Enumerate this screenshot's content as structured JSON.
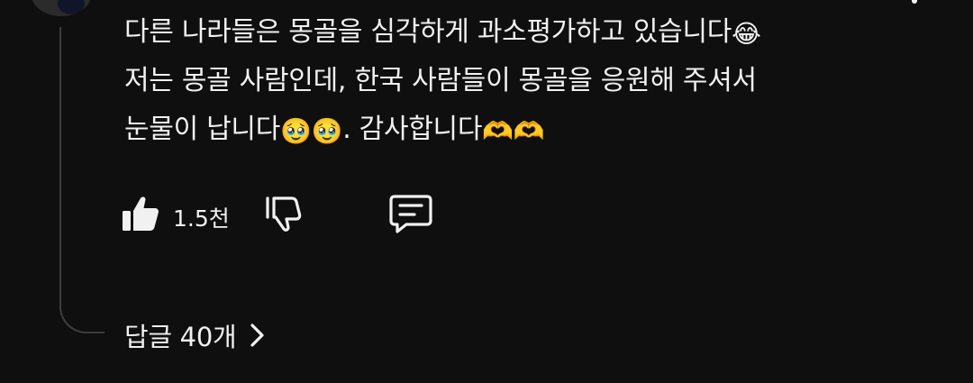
{
  "comment": {
    "lines": [
      {
        "text": "다른 나라들은 몽골을 심각하게 과소평가하고 있습니다",
        "emoji": "😂",
        "tail": ""
      },
      {
        "text": "저는 몽골 사람인데, 한국 사람들이 몽골을 응원해 주셔서",
        "emoji": "",
        "tail": ""
      },
      {
        "text": "눈물이 납니다",
        "emoji": "🥹🥹",
        "tail": ". 감사합니다",
        "emoji2": "🫶🫶"
      }
    ]
  },
  "actions": {
    "like_icon": "thumbs-up-filled-icon",
    "like_count": "1.5천",
    "dislike_icon": "thumbs-down-outline-icon",
    "reply_icon": "comment-reply-icon"
  },
  "replies": {
    "label": "답글 40개",
    "chevron_icon": "chevron-right-icon"
  },
  "colors": {
    "background": "#0f0f0f",
    "text": "#f1f1f1",
    "thread_line": "#3d3d3d"
  }
}
